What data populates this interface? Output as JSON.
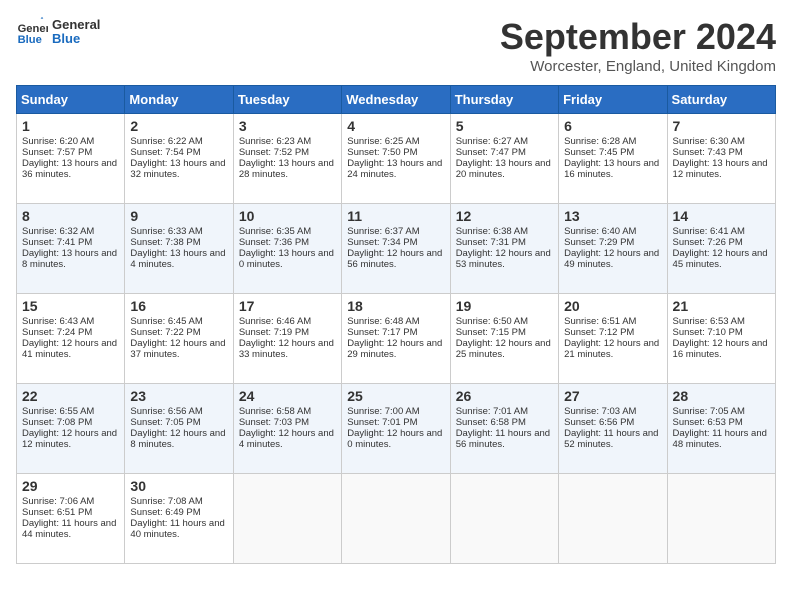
{
  "header": {
    "logo_line1": "General",
    "logo_line2": "Blue",
    "month": "September 2024",
    "location": "Worcester, England, United Kingdom"
  },
  "days_of_week": [
    "Sunday",
    "Monday",
    "Tuesday",
    "Wednesday",
    "Thursday",
    "Friday",
    "Saturday"
  ],
  "weeks": [
    [
      {
        "day": "1",
        "info": "Sunrise: 6:20 AM\nSunset: 7:57 PM\nDaylight: 13 hours and 36 minutes."
      },
      {
        "day": "2",
        "info": "Sunrise: 6:22 AM\nSunset: 7:54 PM\nDaylight: 13 hours and 32 minutes."
      },
      {
        "day": "3",
        "info": "Sunrise: 6:23 AM\nSunset: 7:52 PM\nDaylight: 13 hours and 28 minutes."
      },
      {
        "day": "4",
        "info": "Sunrise: 6:25 AM\nSunset: 7:50 PM\nDaylight: 13 hours and 24 minutes."
      },
      {
        "day": "5",
        "info": "Sunrise: 6:27 AM\nSunset: 7:47 PM\nDaylight: 13 hours and 20 minutes."
      },
      {
        "day": "6",
        "info": "Sunrise: 6:28 AM\nSunset: 7:45 PM\nDaylight: 13 hours and 16 minutes."
      },
      {
        "day": "7",
        "info": "Sunrise: 6:30 AM\nSunset: 7:43 PM\nDaylight: 13 hours and 12 minutes."
      }
    ],
    [
      {
        "day": "8",
        "info": "Sunrise: 6:32 AM\nSunset: 7:41 PM\nDaylight: 13 hours and 8 minutes."
      },
      {
        "day": "9",
        "info": "Sunrise: 6:33 AM\nSunset: 7:38 PM\nDaylight: 13 hours and 4 minutes."
      },
      {
        "day": "10",
        "info": "Sunrise: 6:35 AM\nSunset: 7:36 PM\nDaylight: 13 hours and 0 minutes."
      },
      {
        "day": "11",
        "info": "Sunrise: 6:37 AM\nSunset: 7:34 PM\nDaylight: 12 hours and 56 minutes."
      },
      {
        "day": "12",
        "info": "Sunrise: 6:38 AM\nSunset: 7:31 PM\nDaylight: 12 hours and 53 minutes."
      },
      {
        "day": "13",
        "info": "Sunrise: 6:40 AM\nSunset: 7:29 PM\nDaylight: 12 hours and 49 minutes."
      },
      {
        "day": "14",
        "info": "Sunrise: 6:41 AM\nSunset: 7:26 PM\nDaylight: 12 hours and 45 minutes."
      }
    ],
    [
      {
        "day": "15",
        "info": "Sunrise: 6:43 AM\nSunset: 7:24 PM\nDaylight: 12 hours and 41 minutes."
      },
      {
        "day": "16",
        "info": "Sunrise: 6:45 AM\nSunset: 7:22 PM\nDaylight: 12 hours and 37 minutes."
      },
      {
        "day": "17",
        "info": "Sunrise: 6:46 AM\nSunset: 7:19 PM\nDaylight: 12 hours and 33 minutes."
      },
      {
        "day": "18",
        "info": "Sunrise: 6:48 AM\nSunset: 7:17 PM\nDaylight: 12 hours and 29 minutes."
      },
      {
        "day": "19",
        "info": "Sunrise: 6:50 AM\nSunset: 7:15 PM\nDaylight: 12 hours and 25 minutes."
      },
      {
        "day": "20",
        "info": "Sunrise: 6:51 AM\nSunset: 7:12 PM\nDaylight: 12 hours and 21 minutes."
      },
      {
        "day": "21",
        "info": "Sunrise: 6:53 AM\nSunset: 7:10 PM\nDaylight: 12 hours and 16 minutes."
      }
    ],
    [
      {
        "day": "22",
        "info": "Sunrise: 6:55 AM\nSunset: 7:08 PM\nDaylight: 12 hours and 12 minutes."
      },
      {
        "day": "23",
        "info": "Sunrise: 6:56 AM\nSunset: 7:05 PM\nDaylight: 12 hours and 8 minutes."
      },
      {
        "day": "24",
        "info": "Sunrise: 6:58 AM\nSunset: 7:03 PM\nDaylight: 12 hours and 4 minutes."
      },
      {
        "day": "25",
        "info": "Sunrise: 7:00 AM\nSunset: 7:01 PM\nDaylight: 12 hours and 0 minutes."
      },
      {
        "day": "26",
        "info": "Sunrise: 7:01 AM\nSunset: 6:58 PM\nDaylight: 11 hours and 56 minutes."
      },
      {
        "day": "27",
        "info": "Sunrise: 7:03 AM\nSunset: 6:56 PM\nDaylight: 11 hours and 52 minutes."
      },
      {
        "day": "28",
        "info": "Sunrise: 7:05 AM\nSunset: 6:53 PM\nDaylight: 11 hours and 48 minutes."
      }
    ],
    [
      {
        "day": "29",
        "info": "Sunrise: 7:06 AM\nSunset: 6:51 PM\nDaylight: 11 hours and 44 minutes."
      },
      {
        "day": "30",
        "info": "Sunrise: 7:08 AM\nSunset: 6:49 PM\nDaylight: 11 hours and 40 minutes."
      },
      {
        "day": "",
        "info": ""
      },
      {
        "day": "",
        "info": ""
      },
      {
        "day": "",
        "info": ""
      },
      {
        "day": "",
        "info": ""
      },
      {
        "day": "",
        "info": ""
      }
    ]
  ]
}
